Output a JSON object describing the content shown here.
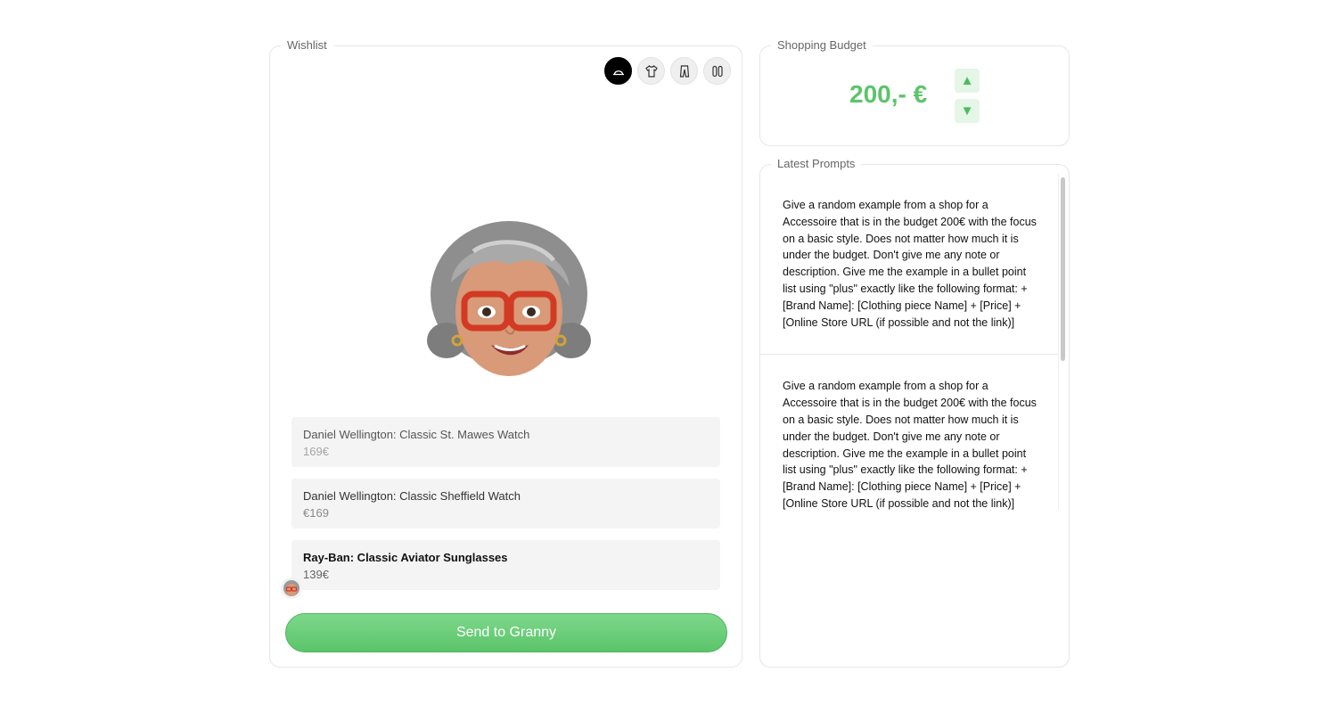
{
  "wishlist": {
    "legend": "Wishlist",
    "categories": [
      {
        "icon": "accessoire-icon",
        "active": true
      },
      {
        "icon": "shirt-icon",
        "active": false
      },
      {
        "icon": "pants-icon",
        "active": false
      },
      {
        "icon": "shoes-icon",
        "active": false
      }
    ],
    "items": [
      {
        "title": "Daniel Wellington: Classic St. Mawes Watch",
        "price": "169€"
      },
      {
        "title": "Daniel Wellington: Classic Sheffield Watch",
        "price": "€169"
      },
      {
        "title": "Ray-Ban: Classic Aviator Sunglasses",
        "price": "139€"
      }
    ],
    "send_label": "Send to Granny"
  },
  "budget": {
    "legend": "Shopping Budget",
    "value": "200,- €",
    "up_label": "▲",
    "down_label": "▼"
  },
  "prompts": {
    "legend": "Latest Prompts",
    "list": [
      "Give a random example from a shop for a Accessoire that is in the budget 200€ with the focus on a basic style. Does not matter how much it is under the budget. Don't give me any note or description. Give me the example in a bullet point list using \"plus\" exactly like the following format: + [Brand Name]: [Clothing piece Name] + [Price] + [Online Store URL (if possible and not the link)]",
      "Give a random example from a shop for a Accessoire that is in the budget 200€ with the focus on a basic style. Does not matter how much it is under the budget. Don't give me any note or description. Give me the example in a bullet point list using \"plus\" exactly like the following format: + [Brand Name]: [Clothing piece Name] + [Price] + [Online Store URL (if possible and not the link)]"
    ]
  },
  "colors": {
    "accent_green": "#5cc46a",
    "button_green": "#6fd07c"
  }
}
